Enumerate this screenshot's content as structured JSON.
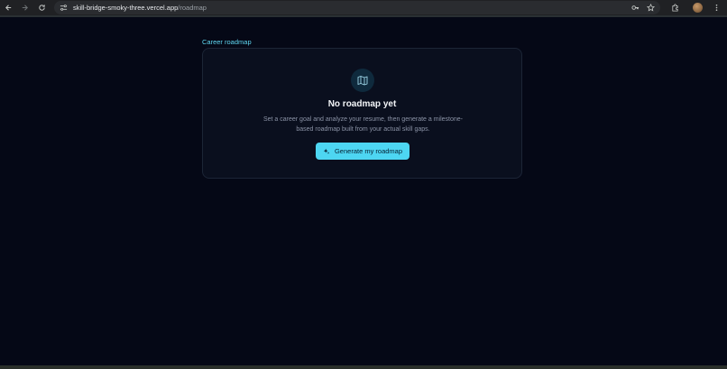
{
  "browser": {
    "url_domain": "skill-bridge-smoky-three.vercel.app",
    "url_path": "/roadmap",
    "icons": [
      "back-icon",
      "forward-icon",
      "reload-icon",
      "site-settings-icon",
      "password-key-icon",
      "bookmark-star-icon",
      "extensions-icon",
      "profile-avatar",
      "more-menu-icon"
    ]
  },
  "page": {
    "section_label": "Career roadmap"
  },
  "empty_state": {
    "icon": "map-icon",
    "title": "No roadmap yet",
    "description": "Set a career goal and analyze your resume, then generate a milestone-based roadmap built from your actual skill gaps.",
    "cta_label": "Generate my roadmap",
    "cta_icon": "sparkles-icon"
  },
  "colors": {
    "background": "#050816",
    "accent": "#4dd6f2",
    "label": "#5fd6f0",
    "card": "#0a0f1e"
  }
}
